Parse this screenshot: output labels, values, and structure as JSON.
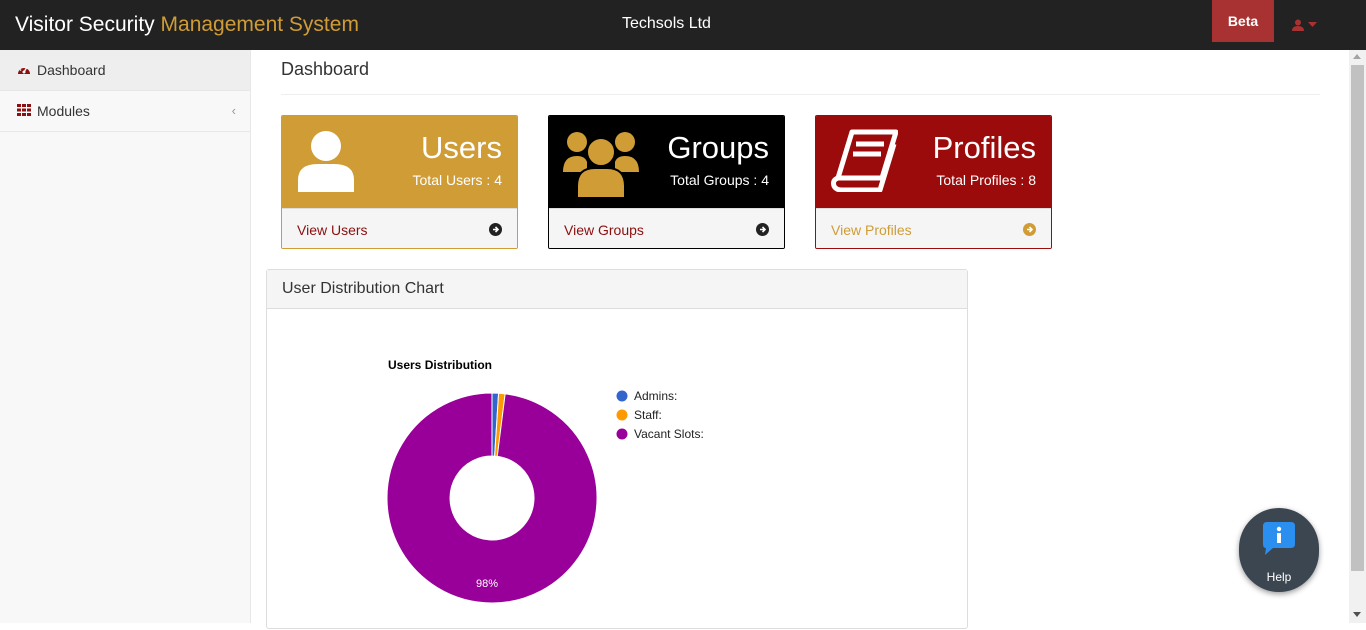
{
  "header": {
    "brand_main": "Visitor Security",
    "brand_accent": "Management System",
    "company": "Techsols Ltd",
    "beta_label": "Beta"
  },
  "sidebar": {
    "items": [
      {
        "label": "Dashboard",
        "icon": "dashboard-icon"
      },
      {
        "label": "Modules",
        "icon": "grid-icon"
      }
    ]
  },
  "page": {
    "title": "Dashboard"
  },
  "cards": [
    {
      "title": "Users",
      "subtitle": "Total Users : 4",
      "link": "View Users",
      "icon": "user-icon",
      "color": "#d09c35"
    },
    {
      "title": "Groups",
      "subtitle": "Total Groups : 4",
      "link": "View Groups",
      "icon": "users-group-icon",
      "color": "#000000"
    },
    {
      "title": "Profiles",
      "subtitle": "Total Profiles : 8",
      "link": "View Profiles",
      "icon": "book-icon",
      "color": "#9b0b0b"
    }
  ],
  "panel": {
    "title": "User Distribution Chart"
  },
  "chart_data": {
    "type": "pie",
    "donut": true,
    "title": "Users Distribution",
    "legend_position": "right",
    "series": [
      {
        "name": "Admins:",
        "value": 1,
        "color": "#3366cc"
      },
      {
        "name": "Staff:",
        "value": 1,
        "color": "#ff9900"
      },
      {
        "name": "Vacant Slots:",
        "value": 98,
        "color": "#990099"
      }
    ],
    "slice_labels": [
      "",
      "",
      "98%"
    ]
  },
  "help": {
    "label": "Help"
  }
}
